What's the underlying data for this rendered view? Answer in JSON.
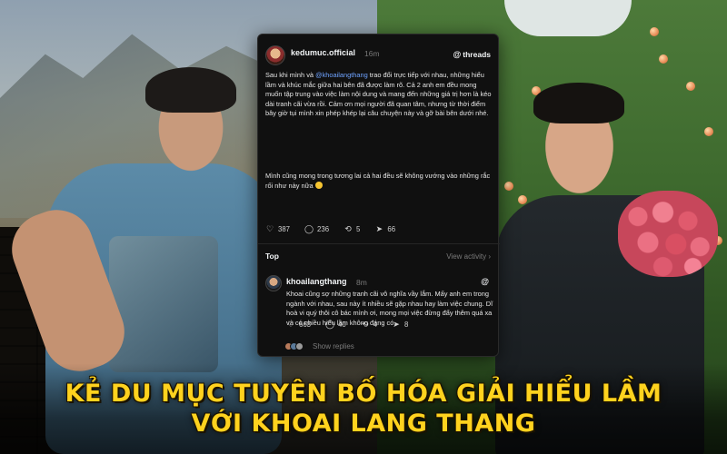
{
  "post": {
    "handle": "kedumuc.official",
    "time": "16m",
    "brand": "threads",
    "mention": "@khoailangthang",
    "para1_before": "Sau khi mình và ",
    "para1_after": " trao đổi trực tiếp với nhau, những hiểu lầm và khúc mắc giữa hai bên đã được làm rõ. Cả 2 anh em đều mong muốn tập trung vào việc làm nội dung và mang đến những giá trị hơn là kéo dài tranh cãi vừa rồi. Cảm ơn mọi người đã quan tâm, nhưng từ thời điểm bây giờ tụi mình xin phép khép lại câu chuyện này và gỡ bài bên dưới nhé.",
    "para2": "Mình cũng mong trong tương lai cả hai  đều sẽ không vướng vào những rắc rối như này nữa",
    "likes": "387",
    "comments": "236",
    "reposts": "5",
    "shares": "66",
    "like_icon": "heart-icon",
    "comment_icon": "comment-icon",
    "repost_icon": "repost-icon",
    "share_icon": "share-icon"
  },
  "section": {
    "top_label": "Top",
    "view_activity": "View activity",
    "chevron": "›"
  },
  "reply": {
    "handle": "khoailangthang",
    "time": "8m",
    "text": "Khoai cũng sợ những tranh cãi vô nghĩa vầy lắm. Mấy anh em trong ngành với nhau, sau này ít nhiều sẽ gặp nhau hay làm việc chung. Dĩ hoà vi quý thôi cô bác mình ơi, mong mọi việc đừng đẩy thêm quá xa và có nhiều hiểu lầm không đáng có.",
    "likes": "663",
    "comments": "40",
    "reposts": "4",
    "shares": "8",
    "show_replies": "Show replies"
  },
  "headline": {
    "line1": "KẺ DU MỤC TUYÊN BỐ HÓA GIẢI HIỂU LẦM",
    "line2": "VỚI KHOAI LANG THANG"
  },
  "colors": {
    "headline": "#ffd21e",
    "card_bg": "#101010",
    "mention": "#6fa3ff"
  }
}
